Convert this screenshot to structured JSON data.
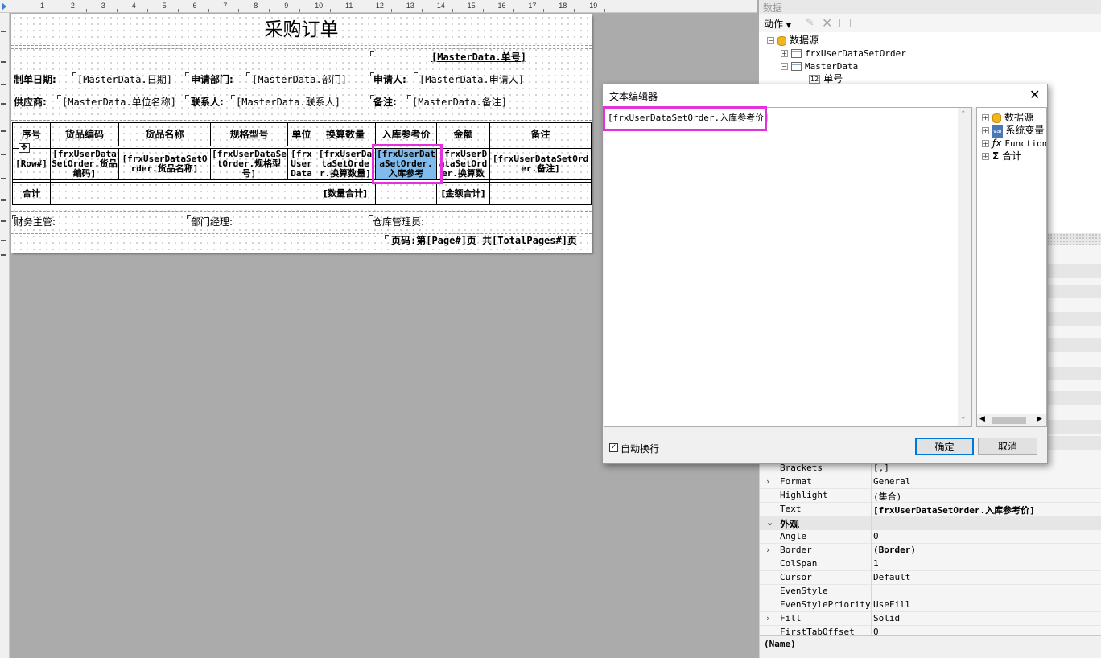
{
  "report": {
    "title": "采购订单",
    "order_no": "[MasterData.单号]",
    "labels": {
      "date": "制单日期:",
      "dept": "申请部门:",
      "applicant": "申请人:",
      "supplier": "供应商:",
      "contact": "联系人:",
      "remark": "备注:"
    },
    "fields": {
      "date": "[MasterData.日期]",
      "dept": "[MasterData.部门]",
      "applicant": "[MasterData.申请人]",
      "supplier": "[MasterData.单位名称]",
      "contact": "[MasterData.联系人]",
      "remark": "[MasterData.备注]"
    },
    "columns": [
      "序号",
      "货品编码",
      "货品名称",
      "规格型号",
      "单位",
      "换算数量",
      "入库参考价",
      "金额",
      "备注"
    ],
    "data_cells": [
      "[Row#]",
      "[frxUserDataSetOrder.货品编码]",
      "[frxUserDataSetOrder.货品名称]",
      "[frxUserDataSetOrder.规格型号]",
      "[frxUserData",
      "[frxUserDataSetOrder.换算数量]",
      "[frxUserDataSetOrder.入库参考",
      "[frxUserDataSetOrder.换算数",
      "[frxUserDataSetOrder.备注]"
    ],
    "total_label": "合计",
    "qty_total": "[数量合计]",
    "amt_total": "[金额合计]",
    "signers": {
      "finance": "财务主管:",
      "manager": "部门经理:",
      "warehouse": "仓库管理员:"
    },
    "page_footer": "页码:第[Page#]页 共[TotalPages#]页"
  },
  "ruler": [
    "1",
    "2",
    "3",
    "4",
    "5",
    "6",
    "7",
    "8",
    "9",
    "10",
    "11",
    "12",
    "13",
    "14",
    "15",
    "16",
    "17",
    "18",
    "19"
  ],
  "data_panel": {
    "title": "数据",
    "action_label": "动作",
    "tree": {
      "root": "数据源",
      "ds1": "frxUserDataSetOrder",
      "ds2": "MasterData",
      "field": "单号"
    }
  },
  "dialog": {
    "title": "文本编辑器",
    "text": "[frxUserDataSetOrder.入库参考价]",
    "tree": {
      "datasource": "数据源",
      "sysvar": "系统变量",
      "functions": "Functions",
      "totals": "合计"
    },
    "wordwrap_label": "自动换行",
    "ok": "确定",
    "cancel": "取消"
  },
  "properties": [
    {
      "name": "Brackets",
      "value": "[,]"
    },
    {
      "name": "Format",
      "value": "General",
      "exp": true
    },
    {
      "name": "Highlight",
      "value": "(集合)"
    },
    {
      "name": "Text",
      "value": "[frxUserDataSetOrder.入库参考价]",
      "bold": true
    },
    {
      "cat": "外观"
    },
    {
      "name": "Angle",
      "value": "0"
    },
    {
      "name": "Border",
      "value": "(Border)",
      "exp": true,
      "bold": true
    },
    {
      "name": "ColSpan",
      "value": "1"
    },
    {
      "name": "Cursor",
      "value": "Default"
    },
    {
      "name": "EvenStyle",
      "value": ""
    },
    {
      "name": "EvenStylePriority",
      "value": "UseFill"
    },
    {
      "name": "Fill",
      "value": "Solid",
      "exp": true
    },
    {
      "name": "FirstTabOffset",
      "value": "0"
    }
  ],
  "status_name": "(Name)"
}
